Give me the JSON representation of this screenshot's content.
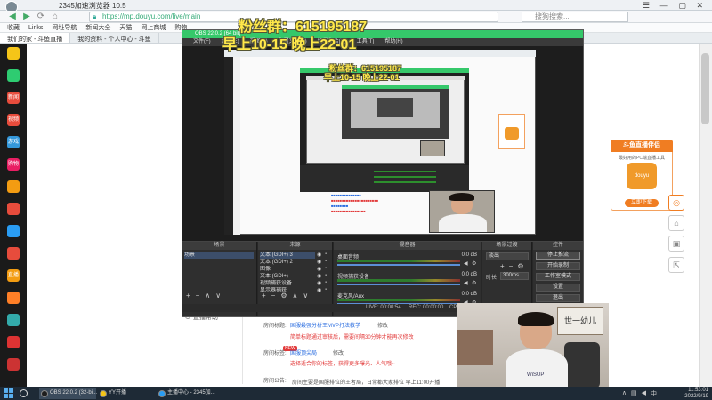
{
  "browser": {
    "window_title": "2345加速浏览器 10.5",
    "url": "https://mp.douyu.com/live/main",
    "search_placeholder": "搜狗搜索...",
    "bookmarks": [
      "收藏",
      "Links",
      "网址导航",
      "新闻大全",
      "天猫",
      "网上商城",
      "购物"
    ],
    "tabs": [
      "我们的家 - 斗鱼直播",
      "我的资料 - 个人中心 - 斗鱼"
    ]
  },
  "sidebar_icons": [
    {
      "label": "",
      "color": "#f5c518"
    },
    {
      "label": "",
      "color": "#2ecc71"
    },
    {
      "label": "新闻",
      "color": "#e74c3c"
    },
    {
      "label": "视频",
      "color": "#e74c3c"
    },
    {
      "label": "游戏",
      "color": "#3498db"
    },
    {
      "label": "购物",
      "color": "#e91e63"
    },
    {
      "label": "",
      "color": "#f39c12"
    },
    {
      "label": "",
      "color": "#e74c3c"
    },
    {
      "label": "",
      "color": "#2a9df4"
    },
    {
      "label": "",
      "color": "#e74c3c"
    },
    {
      "label": "直播",
      "color": "#f39c12"
    },
    {
      "label": "",
      "color": "#ff7f27"
    },
    {
      "label": "",
      "color": "#3aa"
    },
    {
      "label": "",
      "color": "#d33"
    },
    {
      "label": "",
      "color": "#c33"
    }
  ],
  "overlay": {
    "line1": "粉丝群：615195187",
    "line2": "早上10-15 晚上22-01",
    "small_line1": "粉丝群：615195187",
    "small_line2": "早上10-15 晚上22-01"
  },
  "obs": {
    "title": "OBS 22.0.2 (64 bit)",
    "menu": [
      "文件(F)",
      "编辑(E)",
      "视图(V)",
      "配置文件(P)",
      "场景集合(S)",
      "工具(T)",
      "帮助(H)"
    ],
    "panels": {
      "scenes": {
        "header": "场景",
        "items": [
          "场景"
        ]
      },
      "sources": {
        "header": "来源",
        "items": [
          "文本 (GDI+) 3",
          "文本 (GDI+) 2",
          "图像",
          "文本 (GDI+)",
          "视频捕获设备",
          "显示器捕获"
        ]
      },
      "mixer": {
        "header": "混音器",
        "tracks": [
          {
            "name": "桌面音频",
            "db": "0.0 dB"
          },
          {
            "name": "视频捕获设备",
            "db": "0.0 dB"
          },
          {
            "name": "麦克风/Aux",
            "db": "0.0 dB"
          }
        ]
      },
      "transitions": {
        "header": "场景过渡",
        "type": "淡出",
        "duration_label": "时长",
        "duration": "300ms"
      },
      "controls": {
        "header": "控件",
        "buttons": [
          "停止推流",
          "开始录制",
          "工作室模式",
          "设置",
          "退出"
        ]
      }
    },
    "status": {
      "live": "LIVE: 00:00:54",
      "rec": "REC: 00:00:00",
      "cpu": "CPU"
    }
  },
  "ad": {
    "title": "斗鱼直播伴侣",
    "subtitle": "最好用的PC端直播工具",
    "logo_text": "douyu",
    "button": "立即下载"
  },
  "form": {
    "live_help": "直播帮助",
    "title_label": "房间标题:",
    "title_value": "国服最强分析王MVP打法教学",
    "edit": "修改",
    "title_hint": "简单标题通过审核后，需要间隔30分钟才能再次修改",
    "tag_label": "房间标签:",
    "new_tag": "NEW",
    "tag_value": "国服顶尖局",
    "tag_hint": "选择适合你的标签，获得更多曝光、人气哦~",
    "notice_label": "房间公告:",
    "notice_value": "房间主要是国服排位的王者局，日常都大家排位 早上11:00开播"
  },
  "webcam": {
    "calligraphy": "世一幼儿",
    "shirt": "WiSUP"
  },
  "taskbar": {
    "items": [
      {
        "label": "OBS 22.0.2 (32-bi...",
        "color": "#1e1e1e"
      },
      {
        "label": "YY开播",
        "color": "#f5c518"
      },
      {
        "label": "主播中心 - 2345加...",
        "color": "#2a9df4"
      }
    ],
    "time": "11:53:01",
    "date": "2022/9/19"
  }
}
